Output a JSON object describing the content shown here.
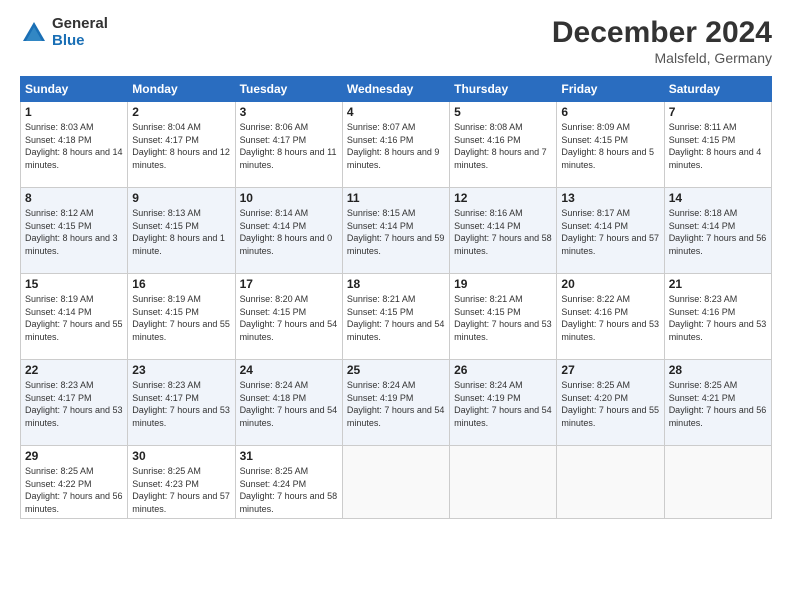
{
  "header": {
    "logo_general": "General",
    "logo_blue": "Blue",
    "title": "December 2024",
    "location": "Malsfeld, Germany"
  },
  "days_of_week": [
    "Sunday",
    "Monday",
    "Tuesday",
    "Wednesday",
    "Thursday",
    "Friday",
    "Saturday"
  ],
  "weeks": [
    [
      {
        "day": "1",
        "sunrise": "8:03 AM",
        "sunset": "4:18 PM",
        "daylight": "8 hours and 14 minutes."
      },
      {
        "day": "2",
        "sunrise": "8:04 AM",
        "sunset": "4:17 PM",
        "daylight": "8 hours and 12 minutes."
      },
      {
        "day": "3",
        "sunrise": "8:06 AM",
        "sunset": "4:17 PM",
        "daylight": "8 hours and 11 minutes."
      },
      {
        "day": "4",
        "sunrise": "8:07 AM",
        "sunset": "4:16 PM",
        "daylight": "8 hours and 9 minutes."
      },
      {
        "day": "5",
        "sunrise": "8:08 AM",
        "sunset": "4:16 PM",
        "daylight": "8 hours and 7 minutes."
      },
      {
        "day": "6",
        "sunrise": "8:09 AM",
        "sunset": "4:15 PM",
        "daylight": "8 hours and 5 minutes."
      },
      {
        "day": "7",
        "sunrise": "8:11 AM",
        "sunset": "4:15 PM",
        "daylight": "8 hours and 4 minutes."
      }
    ],
    [
      {
        "day": "8",
        "sunrise": "8:12 AM",
        "sunset": "4:15 PM",
        "daylight": "8 hours and 3 minutes."
      },
      {
        "day": "9",
        "sunrise": "8:13 AM",
        "sunset": "4:15 PM",
        "daylight": "8 hours and 1 minute."
      },
      {
        "day": "10",
        "sunrise": "8:14 AM",
        "sunset": "4:14 PM",
        "daylight": "8 hours and 0 minutes."
      },
      {
        "day": "11",
        "sunrise": "8:15 AM",
        "sunset": "4:14 PM",
        "daylight": "7 hours and 59 minutes."
      },
      {
        "day": "12",
        "sunrise": "8:16 AM",
        "sunset": "4:14 PM",
        "daylight": "7 hours and 58 minutes."
      },
      {
        "day": "13",
        "sunrise": "8:17 AM",
        "sunset": "4:14 PM",
        "daylight": "7 hours and 57 minutes."
      },
      {
        "day": "14",
        "sunrise": "8:18 AM",
        "sunset": "4:14 PM",
        "daylight": "7 hours and 56 minutes."
      }
    ],
    [
      {
        "day": "15",
        "sunrise": "8:19 AM",
        "sunset": "4:14 PM",
        "daylight": "7 hours and 55 minutes."
      },
      {
        "day": "16",
        "sunrise": "8:19 AM",
        "sunset": "4:15 PM",
        "daylight": "7 hours and 55 minutes."
      },
      {
        "day": "17",
        "sunrise": "8:20 AM",
        "sunset": "4:15 PM",
        "daylight": "7 hours and 54 minutes."
      },
      {
        "day": "18",
        "sunrise": "8:21 AM",
        "sunset": "4:15 PM",
        "daylight": "7 hours and 54 minutes."
      },
      {
        "day": "19",
        "sunrise": "8:21 AM",
        "sunset": "4:15 PM",
        "daylight": "7 hours and 53 minutes."
      },
      {
        "day": "20",
        "sunrise": "8:22 AM",
        "sunset": "4:16 PM",
        "daylight": "7 hours and 53 minutes."
      },
      {
        "day": "21",
        "sunrise": "8:23 AM",
        "sunset": "4:16 PM",
        "daylight": "7 hours and 53 minutes."
      }
    ],
    [
      {
        "day": "22",
        "sunrise": "8:23 AM",
        "sunset": "4:17 PM",
        "daylight": "7 hours and 53 minutes."
      },
      {
        "day": "23",
        "sunrise": "8:23 AM",
        "sunset": "4:17 PM",
        "daylight": "7 hours and 53 minutes."
      },
      {
        "day": "24",
        "sunrise": "8:24 AM",
        "sunset": "4:18 PM",
        "daylight": "7 hours and 54 minutes."
      },
      {
        "day": "25",
        "sunrise": "8:24 AM",
        "sunset": "4:19 PM",
        "daylight": "7 hours and 54 minutes."
      },
      {
        "day": "26",
        "sunrise": "8:24 AM",
        "sunset": "4:19 PM",
        "daylight": "7 hours and 54 minutes."
      },
      {
        "day": "27",
        "sunrise": "8:25 AM",
        "sunset": "4:20 PM",
        "daylight": "7 hours and 55 minutes."
      },
      {
        "day": "28",
        "sunrise": "8:25 AM",
        "sunset": "4:21 PM",
        "daylight": "7 hours and 56 minutes."
      }
    ],
    [
      {
        "day": "29",
        "sunrise": "8:25 AM",
        "sunset": "4:22 PM",
        "daylight": "7 hours and 56 minutes."
      },
      {
        "day": "30",
        "sunrise": "8:25 AM",
        "sunset": "4:23 PM",
        "daylight": "7 hours and 57 minutes."
      },
      {
        "day": "31",
        "sunrise": "8:25 AM",
        "sunset": "4:24 PM",
        "daylight": "7 hours and 58 minutes."
      },
      null,
      null,
      null,
      null
    ]
  ],
  "labels": {
    "sunrise": "Sunrise:",
    "sunset": "Sunset:",
    "daylight": "Daylight:"
  }
}
